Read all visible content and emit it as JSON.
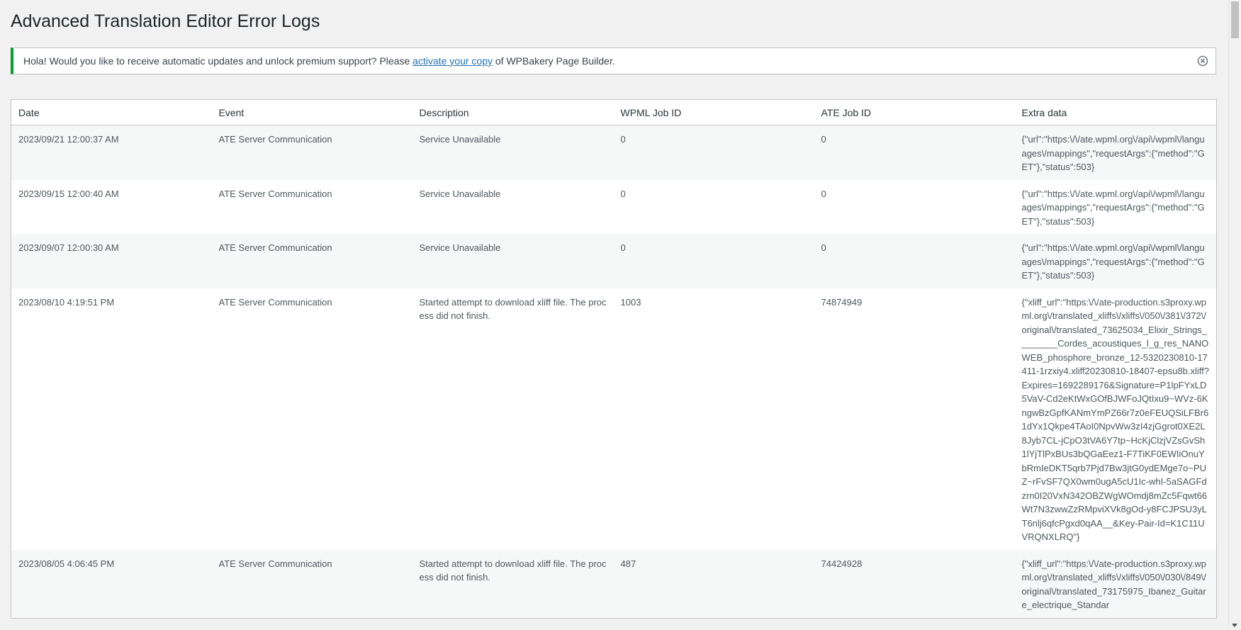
{
  "page": {
    "title": "Advanced Translation Editor Error Logs"
  },
  "notice": {
    "text_before": "Hola! Would you like to receive automatic updates and unlock premium support? Please ",
    "link_text": "activate your copy",
    "text_after": " of WPBakery Page Builder.",
    "accent_color": "#00a32a"
  },
  "table": {
    "headers": {
      "date": "Date",
      "event": "Event",
      "description": "Description",
      "wpml_job_id": "WPML Job ID",
      "ate_job_id": "ATE Job ID",
      "extra_data": "Extra data"
    },
    "rows": [
      {
        "date": "2023/09/21 12:00:37 AM",
        "event": "ATE Server Communication",
        "description": "Service Unavailable",
        "wpml_job_id": "0",
        "ate_job_id": "0",
        "extra_data": "{\"url\":\"https:\\/\\/ate.wpml.org\\/api\\/wpml\\/languages\\/mappings\",\"requestArgs\":{\"method\":\"GET\"},\"status\":503}"
      },
      {
        "date": "2023/09/15 12:00:40 AM",
        "event": "ATE Server Communication",
        "description": "Service Unavailable",
        "wpml_job_id": "0",
        "ate_job_id": "0",
        "extra_data": "{\"url\":\"https:\\/\\/ate.wpml.org\\/api\\/wpml\\/languages\\/mappings\",\"requestArgs\":{\"method\":\"GET\"},\"status\":503}"
      },
      {
        "date": "2023/09/07 12:00:30 AM",
        "event": "ATE Server Communication",
        "description": "Service Unavailable",
        "wpml_job_id": "0",
        "ate_job_id": "0",
        "extra_data": "{\"url\":\"https:\\/\\/ate.wpml.org\\/api\\/wpml\\/languages\\/mappings\",\"requestArgs\":{\"method\":\"GET\"},\"status\":503}"
      },
      {
        "date": "2023/08/10 4:19:51 PM",
        "event": "ATE Server Communication",
        "description": "Started attempt to download xliff file. The process did not finish.",
        "wpml_job_id": "1003",
        "ate_job_id": "74874949",
        "extra_data": "{\"xliff_url\":\"https:\\/\\/ate-production.s3proxy.wpml.org\\/translated_xliffs\\/xliffs\\/050\\/381\\/372\\/original\\/translated_73625034_Elixir_Strings________Cordes_acoustiques_l_g_res_NANOWEB_phosphore_bronze_12-5320230810-17411-1rzxiy4.xliff20230810-18407-epsu8b.xliff?Expires=1692289176&Signature=P1lpFYxLD5VaV-Cd2eKtWxGOfBJWFoJQtIxu9~WVz-6KngwBzGpfKANmYmPZ66r7z0eFEUQSiLFBr61dYx1Qkpe4TAoI0NpvWw3zI4zjGgrot0XE2L8Jyb7CL-jCpO3tVA6Y7tp~HcKjClzjVZsGvSh1lYjTlPxBUs3bQGaEez1-F7TiKF0EWIiOnuYbRmIeDKT5qrb7Pjd7Bw3jtG0ydEMge7o~PUZ~rFvSF7QX0wm0ugA5cU1Ic-whI-5aSAGFdzrn0I20VxN342OBZWgWOmdj8mZc5Fqwt66Wt7N3zwwZzRMpviXVk8gOd-y8FCJPSU3yLT6nlj6qfcPgxd0qAA__&Key-Pair-Id=K1C11UVRQNXLRQ\"}"
      },
      {
        "date": "2023/08/05 4:06:45 PM",
        "event": "ATE Server Communication",
        "description": "Started attempt to download xliff file. The process did not finish.",
        "wpml_job_id": "487",
        "ate_job_id": "74424928",
        "extra_data": "{\"xliff_url\":\"https:\\/\\/ate-production.s3proxy.wpml.org\\/translated_xliffs\\/xliffs\\/050\\/030\\/849\\/original\\/translated_73175975_Ibanez_Guitare_electrique_Standar"
      }
    ]
  }
}
